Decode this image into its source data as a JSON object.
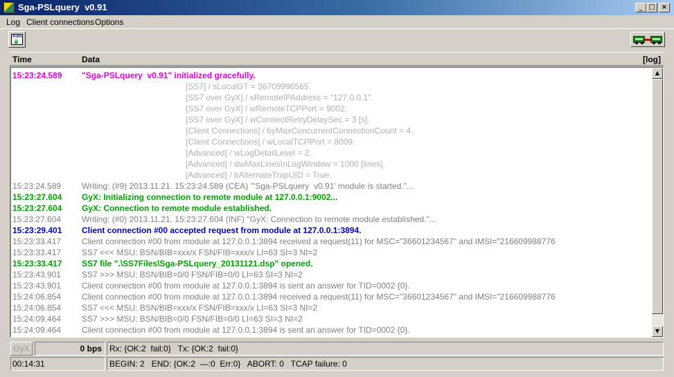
{
  "window": {
    "title": "Sga-PSLquery  v0.91",
    "buttons": {
      "minimize": "_",
      "maximize": "□",
      "close": "×"
    }
  },
  "menu": [
    "Log",
    "Client connections",
    "Options"
  ],
  "toolbar": {
    "auto_label": "Auto"
  },
  "log": {
    "col_time": "Time",
    "col_data": "Data",
    "col_log": "[log]",
    "lines": [
      {
        "time": "15:23:24.589",
        "text": "\"Sga-PSLquery  v0.91\" initialized gracefully.",
        "style": "mag"
      },
      {
        "time": "",
        "text": "[SS7] / sLocalGT = 36709996565.",
        "style": "light",
        "indent": true
      },
      {
        "time": "",
        "text": "[SS7 over GyX] / sRemoteIPAddress = \"127.0.0.1\".",
        "style": "light",
        "indent": true
      },
      {
        "time": "",
        "text": "[SS7 over GyX] / wRemoteTCPPort = 9002.",
        "style": "light",
        "indent": true
      },
      {
        "time": "",
        "text": "[SS7 over GyX] / wConnectRetryDelaySec = 3 [s].",
        "style": "light",
        "indent": true
      },
      {
        "time": "",
        "text": "[Client Connections] / byMaxConcurrentConnectionCount = 4.",
        "style": "light",
        "indent": true
      },
      {
        "time": "",
        "text": "[Client Connections] / wLocalTCPPort = 8009.",
        "style": "light",
        "indent": true
      },
      {
        "time": "",
        "text": "[Advanced] / wLogDetailLevel = 2.",
        "style": "light",
        "indent": true
      },
      {
        "time": "",
        "text": "[Advanced] / dwMaxLinesInLogWindow = 1000 [lines].",
        "style": "light",
        "indent": true
      },
      {
        "time": "",
        "text": "[Advanced] / bAlternateTrapUID = True.",
        "style": "light",
        "indent": true
      },
      {
        "time": "15:23:24.589",
        "text": "Writing: (#9) 2013.11.21. 15:23:24.589 (CEA) '\"Sga-PSLquery  v0.91' module is started.\"...",
        "style": "gray"
      },
      {
        "time": "15:23:27.604",
        "text": "GyX: Initializing connection to remote module at 127.0.0.1:9002...",
        "style": "green"
      },
      {
        "time": "15:23:27.604",
        "text": "GyX: Connection to remote module established.",
        "style": "green"
      },
      {
        "time": "15:23:27.604",
        "text": "Writing: (#0) 2013.11.21. 15:23:27.604 (INF) \"GyX: Connection to remote module established.\"...",
        "style": "gray"
      },
      {
        "time": "15:23:29.401",
        "text": "Client connection #00 accepted request from module at 127.0.0.1:3894.",
        "style": "blue"
      },
      {
        "time": "15:23:33.417",
        "text": "Client connection #00 from module at 127.0.0.1:3894 received a request(11) for MSC=\"36601234567\" and IMSI=\"216609988776",
        "style": "gray"
      },
      {
        "time": "15:23:33.417",
        "text": "SS7 <<< MSU: BSN/BIB=xxx/x FSN/FIB=xxx/x LI=63 SI=3 NI=2",
        "style": "gray"
      },
      {
        "time": "15:23:33.417",
        "text": "SS7 file \".\\SS7Files\\Sga-PSLquery_20131121.dsp\" opened.",
        "style": "green"
      },
      {
        "time": "15:23:43.901",
        "text": "SS7 >>> MSU: BSN/BIB=0/0 FSN/FIB=0/0 LI=63 SI=3 NI=2",
        "style": "gray"
      },
      {
        "time": "15:23:43.901",
        "text": "Client connection #00 from module at 127.0.0.1:3894 is sent an answer for TID=0002 {0}.",
        "style": "gray"
      },
      {
        "time": "15:24:06.854",
        "text": "Client connection #00 from module at 127.0.0.1:3894 received a request(11) for MSC=\"36601234567\" and IMSI=\"216609988776",
        "style": "gray"
      },
      {
        "time": "15:24:06.854",
        "text": "SS7 <<< MSU: BSN/BIB=xxx/x FSN/FIB=xxx/x LI=63 SI=3 NI=2",
        "style": "gray"
      },
      {
        "time": "15:24:09.464",
        "text": "SS7 >>> MSU: BSN/BIB=0/0 FSN/FIB=0/0 LI=63 SI=3 NI=2",
        "style": "gray"
      },
      {
        "time": "15:24:09.464",
        "text": "Client connection #00 from module at 127.0.0.1:3894 is sent an answer for TID=0002 {0}.",
        "style": "gray"
      }
    ]
  },
  "status": {
    "gyx_label": "GyX",
    "bps": "0 bps",
    "rx_tx": "Rx: {OK:2  fail:0}   Tx: {OK:2  fail:0}",
    "uptime": "00:14:31",
    "counters": "BEGIN: 2   END: {OK:2  —:0  Err:0}   ABORT: 0   TCAP failure: 0"
  },
  "colors": {
    "titlebar_start": "#0a246a",
    "titlebar_end": "#a6caf0",
    "magenta": "#e000e0",
    "green": "#00a000",
    "blue": "#0000c0",
    "gray": "#808080"
  }
}
